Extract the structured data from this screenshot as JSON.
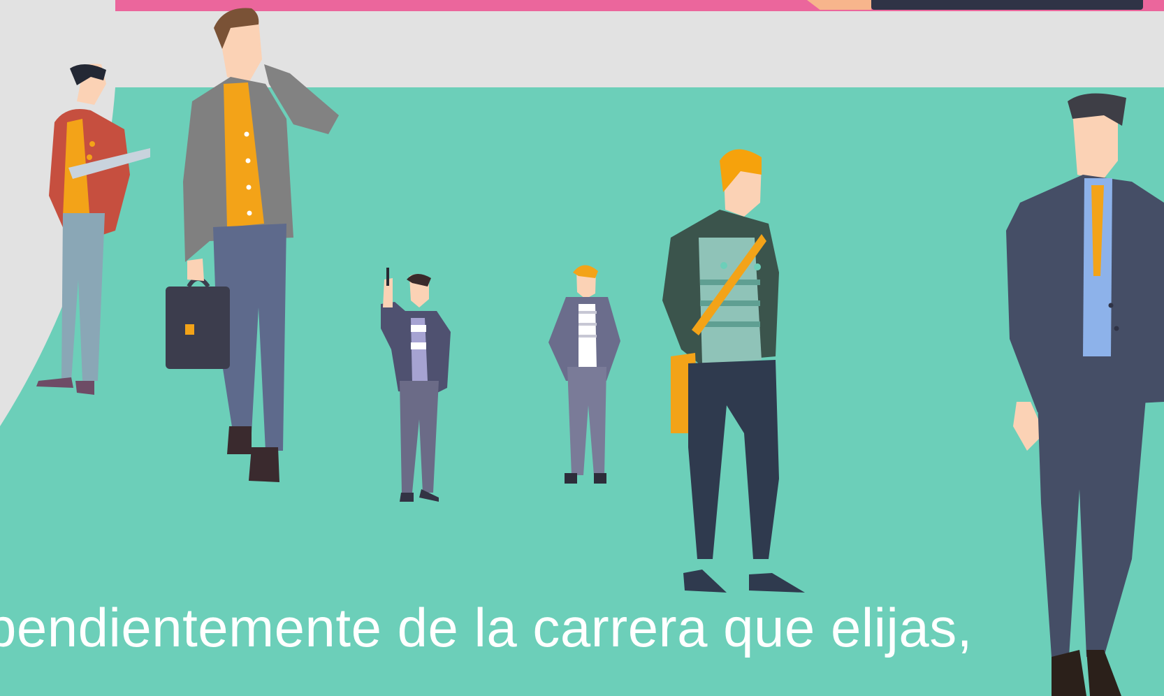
{
  "caption": {
    "line1": "pendientemente de la carrera que elijas,"
  },
  "colors": {
    "teal_floor": "#6ccfb9",
    "wall": "#e2e2e2",
    "pink_strip": "#eb669c",
    "accent_orange": "#f3a318",
    "suit_dark": "#454e66"
  },
  "figures": [
    "man-red-jacket-with-rolled-plans",
    "man-grey-blazer-on-phone-with-briefcase",
    "small-man-holding-pen",
    "small-man-blonde-grey-suit",
    "man-green-jacket-orange-bag",
    "man-navy-suit-orange-tie"
  ]
}
